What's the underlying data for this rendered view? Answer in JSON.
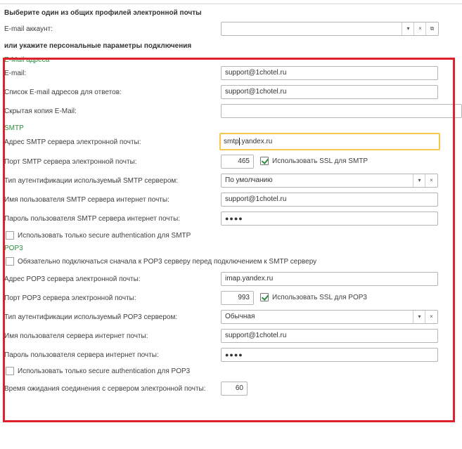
{
  "header": {
    "choose_profile": "Выберите один из общих профилей электронной почты",
    "email_account_label": "E-mail аккаунт:",
    "email_account_value": "",
    "or_specify": "или укажите персональные параметры подключения"
  },
  "email_section": {
    "title": "E-Mail адреса",
    "email_label": "E-mail:",
    "email_value": "support@1chotel.ru",
    "reply_label": "Список E-mail адресов для ответов:",
    "reply_value": "support@1chotel.ru",
    "bcc_label": "Скрытая копия E-Mail:",
    "bcc_value": ""
  },
  "smtp": {
    "title": "SMTP",
    "server_label": "Адрес SMTP сервера электронной почты:",
    "server_value_before_cursor": "smtp",
    "server_value_after_cursor": ".yandex.ru",
    "port_label": "Порт SMTP сервера электронной почты:",
    "port_value": "465",
    "ssl_label": "Использовать SSL для SMTP",
    "ssl_checked": true,
    "auth_label": "Тип аутентификации используемый SMTP сервером:",
    "auth_value": "По умолчанию",
    "user_label": "Имя пользователя SMTP сервера интернет почты:",
    "user_value": "support@1chotel.ru",
    "password_label": "Пароль пользователя SMTP сервера интернет почты:",
    "password_value": "●●●●",
    "secure_auth_label": "Использовать только secure authentication для SMTP",
    "secure_auth_checked": false
  },
  "pop3": {
    "title": "POP3",
    "connect_first_label": "Обязательно подключаться сначала к POP3 серверу перед подключением к SMTP серверу",
    "connect_first_checked": false,
    "server_label": "Адрес POP3 сервера электронной почты:",
    "server_value": "imap.yandex.ru",
    "port_label": "Порт POP3 сервера электронной почты:",
    "port_value": "993",
    "ssl_label": "Использовать SSL для POP3",
    "ssl_checked": true,
    "auth_label": "Тип аутентификации используемый POP3 сервером:",
    "auth_value": "Обычная",
    "user_label": "Имя пользователя сервера интернет почты:",
    "user_value": "support@1chotel.ru",
    "password_label": "Пароль пользователя сервера интернет почты:",
    "password_value": "●●●●",
    "secure_auth_label": "Использовать только secure authentication для POP3",
    "secure_auth_checked": false
  },
  "timeout": {
    "label": "Время ожидания соединения с сервером электронной почты:",
    "value": "60"
  },
  "icons": {
    "dropdown": "▾",
    "clear": "×",
    "open": "⧉"
  },
  "colors": {
    "section_title": "#2e8b3e",
    "highlight_frame": "#e0202a",
    "focus_border": "#f2c94c"
  }
}
